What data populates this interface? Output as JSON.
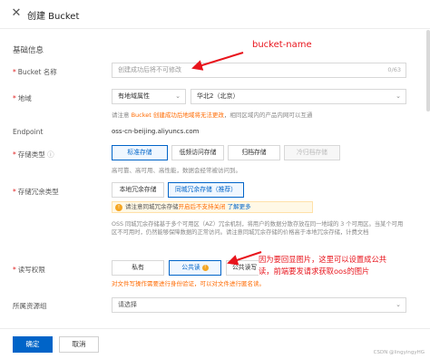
{
  "header": {
    "close_icon": "close-icon",
    "title": "创建 Bucket"
  },
  "section": {
    "basic_info": "基础信息"
  },
  "bucket_name": {
    "label": "Bucket 名称",
    "placeholder": "创建成功后将不可修改",
    "counter": "0/63"
  },
  "region": {
    "label": "地域",
    "type_value": "有地域属性",
    "region_value": "华北2（北京）",
    "hint_prefix": "请注意",
    "hint_accent": "Bucket 创建成功后地域将无法更改",
    "hint_suffix": "，相同区域内的产品内网可以互通"
  },
  "endpoint": {
    "label": "Endpoint",
    "value": "oss-cn-beijing.aliyuncs.com"
  },
  "storage_type": {
    "label": "存储类型",
    "options": [
      "标准存储",
      "低频访问存储",
      "归档存储",
      "冷归档存储"
    ],
    "selected_index": 0,
    "hint": "高可靠、高可用、高性能，数据会经常被访问到。"
  },
  "redundancy": {
    "label": "存储冗余类型",
    "options": [
      "本地冗余存储",
      "同城冗余存储（推荐）"
    ],
    "selected_index": 1,
    "notice_prefix": "请注意同城冗余存储",
    "notice_accent": "开启后不支持关闭",
    "notice_link": "了解更多",
    "paragraph": "OSS 同城冗余存储基于多个可用区（AZ）冗余机制，将用户的数据分散存放在同一地域的 3 个可用区。当某个可用区不可用时，仍然能够保障数据的正常访问。请注意同城冗余存储的价格高于本地冗余存储，计费文档",
    "paragraph_link": "计费文档"
  },
  "acl": {
    "label": "读写权限",
    "options": [
      "私有",
      "公共读",
      "公共读写"
    ],
    "selected_index": 1,
    "note": "对文件写操作需要进行身份验证，可以对文件进行匿名读。"
  },
  "resource_group": {
    "label": "所属资源组",
    "value": "请选择"
  },
  "annotations": {
    "bucket_name": "bucket-name",
    "acl_line1": "因为要回显图片，这里可以设置成公共",
    "acl_line2": "读，前端要发请求获取oos的图片"
  },
  "footer": {
    "confirm": "确定",
    "cancel": "取消"
  },
  "watermark": "CSDN @lingyingyHG",
  "colors": {
    "primary": "#0064c8",
    "accent": "#ff6a00",
    "annotation": "#e8141c"
  }
}
